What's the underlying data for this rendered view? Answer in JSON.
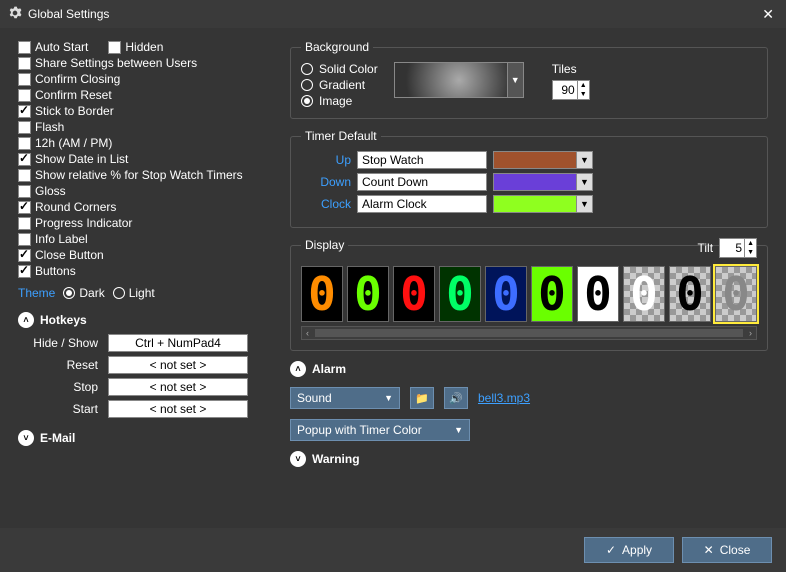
{
  "window": {
    "title": "Global Settings"
  },
  "checks": {
    "autoStart": {
      "label": "Auto Start",
      "checked": false
    },
    "hidden": {
      "label": "Hidden",
      "checked": false
    },
    "shareUsers": {
      "label": "Share Settings between Users",
      "checked": false
    },
    "confirmClosing": {
      "label": "Confirm Closing",
      "checked": false
    },
    "confirmReset": {
      "label": "Confirm Reset",
      "checked": false
    },
    "stickBorder": {
      "label": "Stick to Border",
      "checked": true
    },
    "flash": {
      "label": "Flash",
      "checked": false
    },
    "ampm": {
      "label": "12h (AM / PM)",
      "checked": false
    },
    "showDate": {
      "label": "Show Date in List",
      "checked": true
    },
    "relPercent": {
      "label": "Show relative % for Stop Watch Timers",
      "checked": false
    },
    "gloss": {
      "label": "Gloss",
      "checked": false
    },
    "roundCorners": {
      "label": "Round Corners",
      "checked": true
    },
    "progress": {
      "label": "Progress Indicator",
      "checked": false
    },
    "infoLabel": {
      "label": "Info Label",
      "checked": false
    },
    "closeBtn": {
      "label": "Close Button",
      "checked": true
    },
    "buttons": {
      "label": "Buttons",
      "checked": true
    }
  },
  "theme": {
    "label": "Theme",
    "dark": "Dark",
    "light": "Light",
    "value": "dark"
  },
  "hotkeys": {
    "title": "Hotkeys",
    "hideShow": {
      "label": "Hide / Show",
      "value": "Ctrl + NumPad4"
    },
    "reset": {
      "label": "Reset",
      "value": "< not set >"
    },
    "stop": {
      "label": "Stop",
      "value": "< not set >"
    },
    "start": {
      "label": "Start",
      "value": "< not set >"
    }
  },
  "email": {
    "title": "E-Mail"
  },
  "background": {
    "legend": "Background",
    "solid": "Solid Color",
    "gradient": "Gradient",
    "image": "Image",
    "selected": "image",
    "tilesLabel": "Tiles",
    "tiles": "90"
  },
  "timerDefault": {
    "legend": "Timer Default",
    "up": {
      "label": "Up",
      "name": "Stop Watch",
      "color": "#a0522d"
    },
    "down": {
      "label": "Down",
      "name": "Count Down",
      "color": "#6a3fd8"
    },
    "clock": {
      "label": "Clock",
      "name": "Alarm Clock",
      "color": "#8fff1f"
    }
  },
  "display": {
    "legend": "Display",
    "tiltLabel": "Tilt",
    "tilt": "5",
    "styles": [
      {
        "bg": "#000",
        "fg": "#ff8c00"
      },
      {
        "bg": "#000",
        "fg": "#6aff00"
      },
      {
        "bg": "#000",
        "fg": "#ff1010"
      },
      {
        "bg": "#003300",
        "fg": "#00ff66"
      },
      {
        "bg": "#00145a",
        "fg": "#3d6dff"
      },
      {
        "bg": "#6aff00",
        "fg": "#000"
      },
      {
        "bg": "#fff",
        "fg": "#000"
      },
      {
        "bg": "checker",
        "fg": "#fff"
      },
      {
        "bg": "checker",
        "fg": "#000"
      },
      {
        "bg": "checker",
        "fg": "#888",
        "sel": true
      }
    ]
  },
  "alarm": {
    "title": "Alarm",
    "mode": "Sound",
    "file": "bell3.mp3",
    "popup": "Popup with Timer Color"
  },
  "warning": {
    "title": "Warning"
  },
  "footer": {
    "apply": "Apply",
    "close": "Close"
  }
}
